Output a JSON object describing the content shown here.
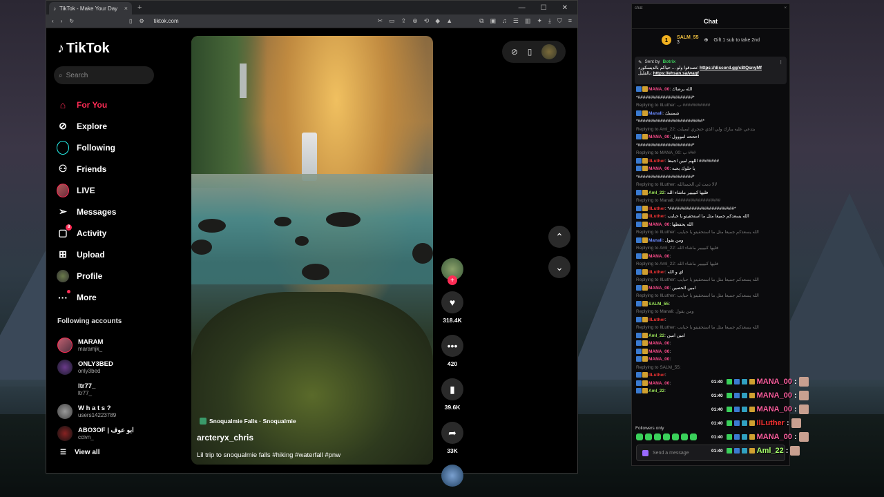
{
  "browser": {
    "tab_title": "TikTok - Make Your Day",
    "url": "tiktok.com",
    "tab_close": "×",
    "new_tab": "+",
    "win_controls": [
      "—",
      "☐",
      "✕"
    ]
  },
  "tiktok": {
    "logo": "TikTok",
    "search_placeholder": "Search",
    "nav": [
      {
        "label": "For You",
        "icon": "home-icon",
        "active": true
      },
      {
        "label": "Explore",
        "icon": "compass-icon"
      },
      {
        "label": "Following",
        "icon": "following-icon"
      },
      {
        "label": "Friends",
        "icon": "friends-icon"
      },
      {
        "label": "LIVE",
        "icon": "live-icon"
      },
      {
        "label": "Messages",
        "icon": "messages-icon"
      },
      {
        "label": "Activity",
        "icon": "activity-icon",
        "badge": "8"
      },
      {
        "label": "Upload",
        "icon": "upload-icon"
      },
      {
        "label": "Profile",
        "icon": "profile-icon"
      },
      {
        "label": "More",
        "icon": "more-icon"
      }
    ],
    "following_title": "Following accounts",
    "accounts": [
      {
        "name": "MARAM",
        "handle": "maramjk_"
      },
      {
        "name": "ONLY3BED",
        "handle": "only3bed"
      },
      {
        "name": "ltr77_",
        "handle": "ltr77_"
      },
      {
        "name": "W h a t s ?",
        "handle": "users14223789"
      },
      {
        "name": "ABO3OF | ابو عوف",
        "handle": "ccivn_"
      }
    ],
    "view_all": "View all",
    "video": {
      "location": "Snoqualmie Falls · Snoqualmie",
      "author": "arcteryx_chris",
      "caption": "Lil trip to snoqualmie falls #hiking #waterfall #pnw"
    },
    "actions": {
      "likes": "318.4K",
      "comments": "420",
      "saves": "39.6K",
      "shares": "33K"
    }
  },
  "chat": {
    "window_label": "chat",
    "title": "Chat",
    "leader_rank": "1",
    "leader_name": "SALM_55",
    "leader_count": "3",
    "leader_gift": "Gift 1 sub to take 2nd",
    "pinned_by": "Sent by",
    "pinned_bot": "Botrix",
    "pinned_text": "تصدقوا ولو ... حياكم بالديسكورد:",
    "pinned_link1": "https://discord.gg/c8tQsnyMf",
    "pinned_text2": "بالقليل:",
    "pinned_link2": "https://ehsan.sa/waqf",
    "messages": [
      {
        "reply": "",
        "user": "MANA_00",
        "cls": "u-pink",
        "text": "الله يرضاك"
      },
      {
        "reply": "",
        "user": "",
        "cls": "",
        "text": "*######################*"
      },
      {
        "reply": "Replying to IlLuther: ب ###########",
        "user": "Manali",
        "cls": "u-blue",
        "text": "شمسك"
      },
      {
        "reply": "",
        "user": "",
        "cls": "",
        "text": "*##########################*"
      },
      {
        "reply": "Replying to Aml_22: يتدعي عليه يبارك ولي الذي حنجري ايميلت",
        "user": "MANA_00",
        "cls": "u-pink",
        "text": "احححه امووول"
      },
      {
        "reply": "",
        "user": "",
        "cls": "",
        "text": "*######################*"
      },
      {
        "reply": "Replying to MANA_00: ب ###",
        "user": "IlLuther",
        "cls": "u-red",
        "text": "اللهم امين اجمعا ########"
      },
      {
        "reply": "",
        "user": "MANA_00",
        "cls": "u-pink",
        "text": "يا حلوك يحبه"
      },
      {
        "reply": "",
        "user": "",
        "cls": "",
        "text": "*######################*"
      },
      {
        "reply": "Replying to IlLuther: لالا دمت لي الحمدالله",
        "user": "Aml_22",
        "cls": "u-green",
        "text": "فليها كبيييير ماشاء الله"
      },
      {
        "reply": "Replying to Manali: ##################",
        "user": "IlLuther",
        "cls": "u-red",
        "text": "*##########################*"
      },
      {
        "reply": "",
        "user": "IlLuther",
        "cls": "u-red",
        "text": "الله يسعدكم جميعا مثل ما استحقيتو يا حبايب"
      },
      {
        "reply": "",
        "user": "MANA_00",
        "cls": "u-pink",
        "text": "الله يحفظها"
      },
      {
        "reply": "Replying to IlLuther: الله يسعدكم جميعا مثل ما استحقيتو يا حبايب",
        "user": "Manali",
        "cls": "u-blue",
        "text": "ومن يقول"
      },
      {
        "reply": "Replying to Aml_22: فليها كبيييير ماشاء الله",
        "user": "MANA_00",
        "cls": "u-pink",
        "text": ""
      },
      {
        "reply": "Replying to Aml_22: فليها كبيييير ماشاء الله",
        "user": "IlLuther",
        "cls": "u-red",
        "text": "اي و الله"
      },
      {
        "reply": "Replying to IlLuther: الله يسعدكم جميعا مثل ما استحقيتو يا حبايب",
        "user": "MANA_00",
        "cls": "u-pink",
        "text": "امين الحصين"
      },
      {
        "reply": "Replying to IlLuther: الله يسعدكم جميعا مثل ما استحقيتو يا حبايب",
        "user": "SALM_55",
        "cls": "u-green",
        "text": ""
      },
      {
        "reply": "Replying to Manali: ومن يقول",
        "user": "IlLuther",
        "cls": "u-red",
        "text": ""
      },
      {
        "reply": "Replying to IlLuther: الله يسعدكم جميعا مثل ما استحقيتو يا حبايب",
        "user": "Aml_22",
        "cls": "u-green",
        "text": "امين امين"
      },
      {
        "reply": "",
        "user": "MANA_00",
        "cls": "u-pink",
        "text": ""
      },
      {
        "reply": "",
        "user": "MANA_00",
        "cls": "u-pink",
        "text": ""
      },
      {
        "reply": "",
        "user": "MANA_00",
        "cls": "u-pink",
        "text": ""
      },
      {
        "reply": "Replying to SALM_55:",
        "user": "IlLuther",
        "cls": "u-red",
        "text": ""
      },
      {
        "reply": "",
        "user": "MANA_00",
        "cls": "u-pink",
        "text": ""
      },
      {
        "reply": "",
        "user": "Aml_22",
        "cls": "u-green",
        "text": ""
      }
    ],
    "followers_only": "Followers only",
    "send_placeholder": "Send a message"
  },
  "overlay": [
    {
      "time": "01:40",
      "user": "MANA_00",
      "cls": "ov-pink"
    },
    {
      "time": "01:40",
      "user": "MANA_00",
      "cls": "ov-pink"
    },
    {
      "time": "01:40",
      "user": "MANA_00",
      "cls": "ov-pink"
    },
    {
      "time": "01:40",
      "user": "IlLuther",
      "cls": "ov-red"
    },
    {
      "time": "01:40",
      "user": "MANA_00",
      "cls": "ov-pink"
    },
    {
      "time": "01:40",
      "user": "Aml_22",
      "cls": "ov-green"
    }
  ]
}
